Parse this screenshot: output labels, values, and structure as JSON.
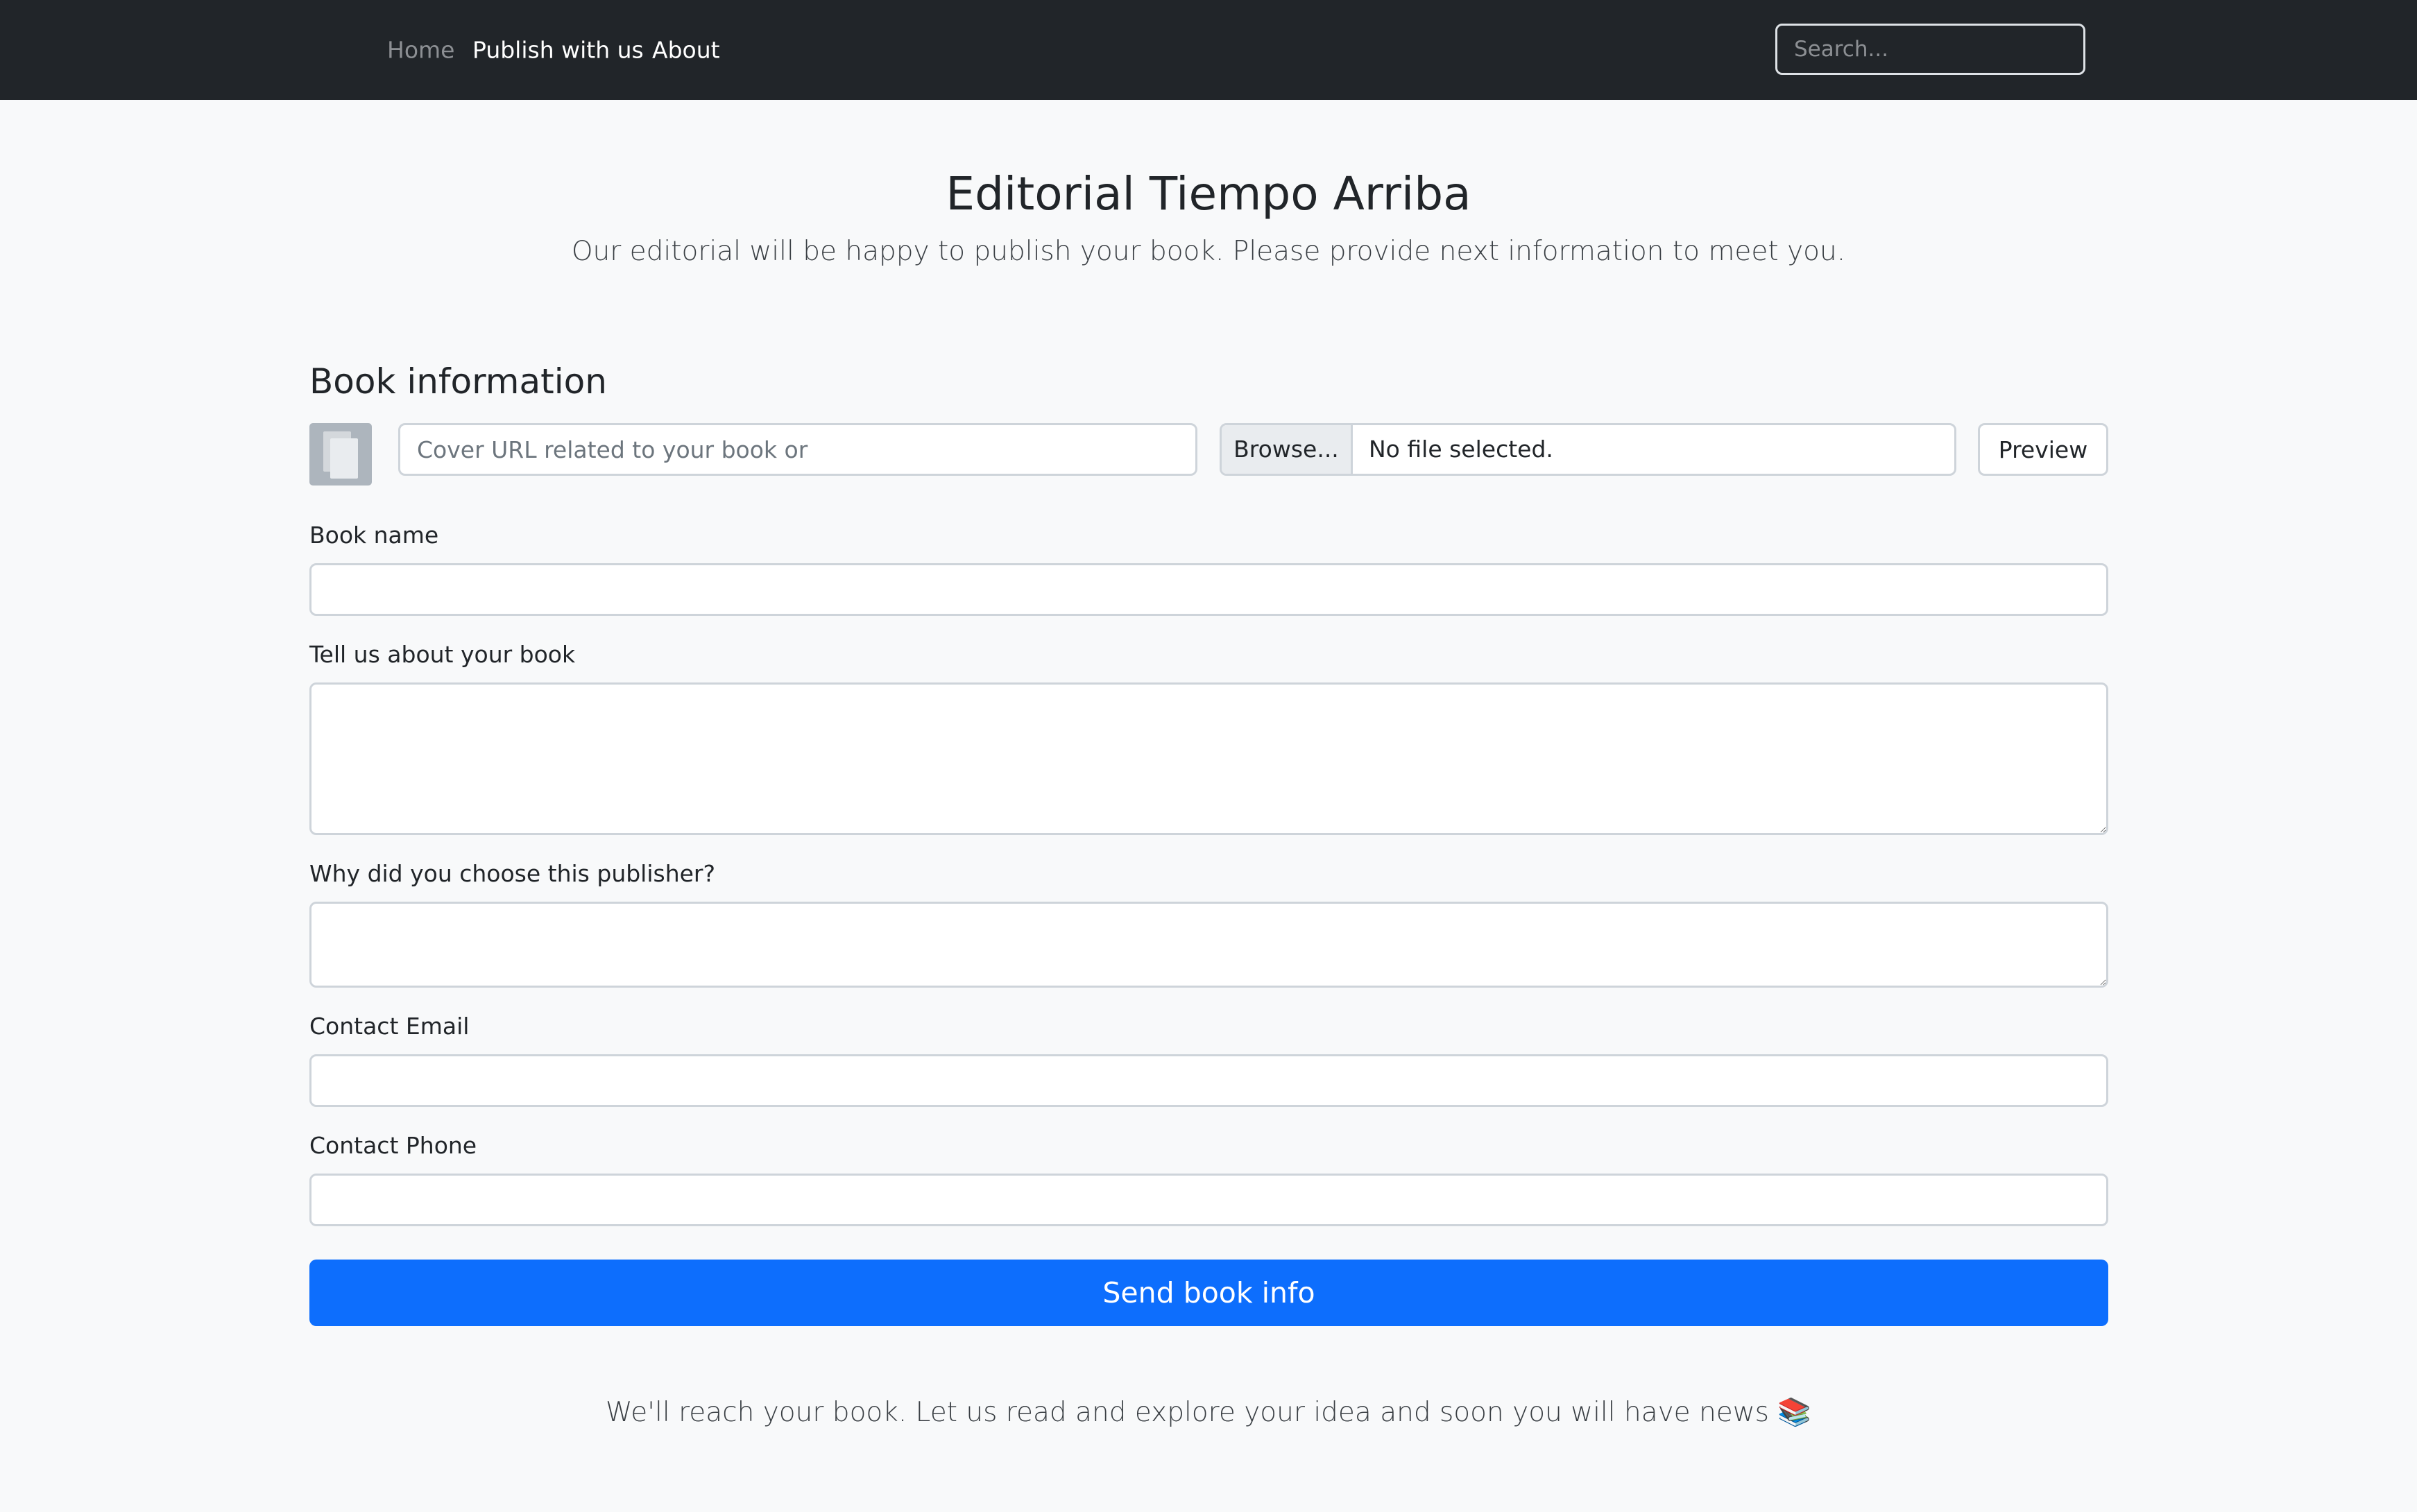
{
  "nav": {
    "links": [
      {
        "label": "Home"
      },
      {
        "label": "Publish with us"
      },
      {
        "label": "About"
      }
    ],
    "search_placeholder": "Search..."
  },
  "header": {
    "title": "Editorial Tiempo Arriba",
    "subtitle": "Our editorial will be happy to publish your book. Please provide next information to meet you."
  },
  "form": {
    "section_title": "Book information",
    "cover": {
      "url_placeholder": "Cover URL related to your book or",
      "url_value": "",
      "browse_label": "Browse...",
      "file_status": "No file selected.",
      "preview_label": "Preview",
      "thumb_icon": "image-placeholder-icon"
    },
    "book_name": {
      "label": "Book name",
      "value": ""
    },
    "about_book": {
      "label": "Tell us about your book",
      "value": ""
    },
    "why_publisher": {
      "label": "Why did you choose this publisher?",
      "value": ""
    },
    "contact_email": {
      "label": "Contact Email",
      "value": ""
    },
    "contact_phone": {
      "label": "Contact Phone",
      "value": ""
    },
    "submit_label": "Send book info"
  },
  "footer": {
    "note": "We'll reach your book. Let us read and explore your idea and soon you will have news 📚"
  },
  "colors": {
    "navbar_bg": "#212529",
    "page_bg": "#f8f9fa",
    "primary": "#0d6efd",
    "input_border": "#ced4da"
  }
}
